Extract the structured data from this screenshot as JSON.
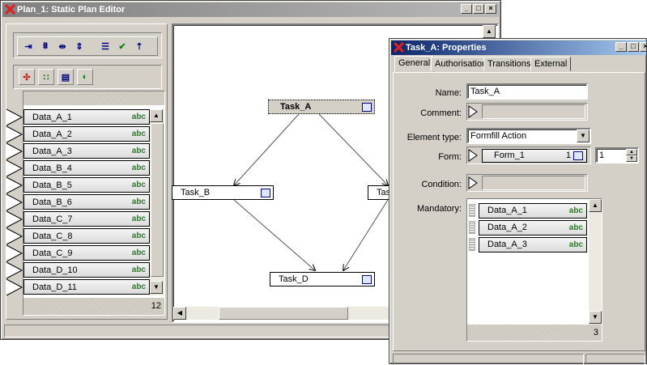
{
  "editor": {
    "title": "Plan_1: Static Plan Editor",
    "toolbar_tools": [
      "align-left-icon",
      "align-top-icon",
      "align-center-h-icon",
      "align-center-v-icon",
      "list-icon",
      "check-icon",
      "sort-up-icon"
    ],
    "palette_tools": [
      "layout-icon",
      "grid-icon",
      "list-view-icon",
      "toggle-icon"
    ],
    "data_items": [
      "Data_A_1",
      "Data_A_2",
      "Data_A_3",
      "Data_B_4",
      "Data_B_5",
      "Data_B_6",
      "Data_C_7",
      "Data_C_8",
      "Data_C_9",
      "Data_D_10",
      "Data_D_11"
    ],
    "data_type_badge": "abc",
    "data_count": "12",
    "nodes": {
      "task_a": "Task_A",
      "task_b": "Task_B",
      "task_c": "Tas",
      "task_d": "Task_D"
    }
  },
  "properties": {
    "title": "Task_A: Properties",
    "tabs": [
      "General",
      "Authorisation",
      "Transitions",
      "External"
    ],
    "active_tab": "General",
    "labels": {
      "name": "Name:",
      "comment": "Comment:",
      "element_type": "Element type:",
      "form": "Form:",
      "condition": "Condition:",
      "mandatory": "Mandatory:"
    },
    "name_value": "Task_A",
    "element_type_value": "Formfill Action",
    "form_value": "Form_1",
    "form_count": "1",
    "form_number": "1",
    "mandatory_items": [
      "Data_A_1",
      "Data_A_2",
      "Data_A_3"
    ],
    "mandatory_badge": "abc",
    "mandatory_count": "3"
  },
  "colors": {
    "face": "#d4d0c8",
    "title_active": "#0a246a",
    "title_inactive": "#808080",
    "badge": "#2a7a2a"
  }
}
